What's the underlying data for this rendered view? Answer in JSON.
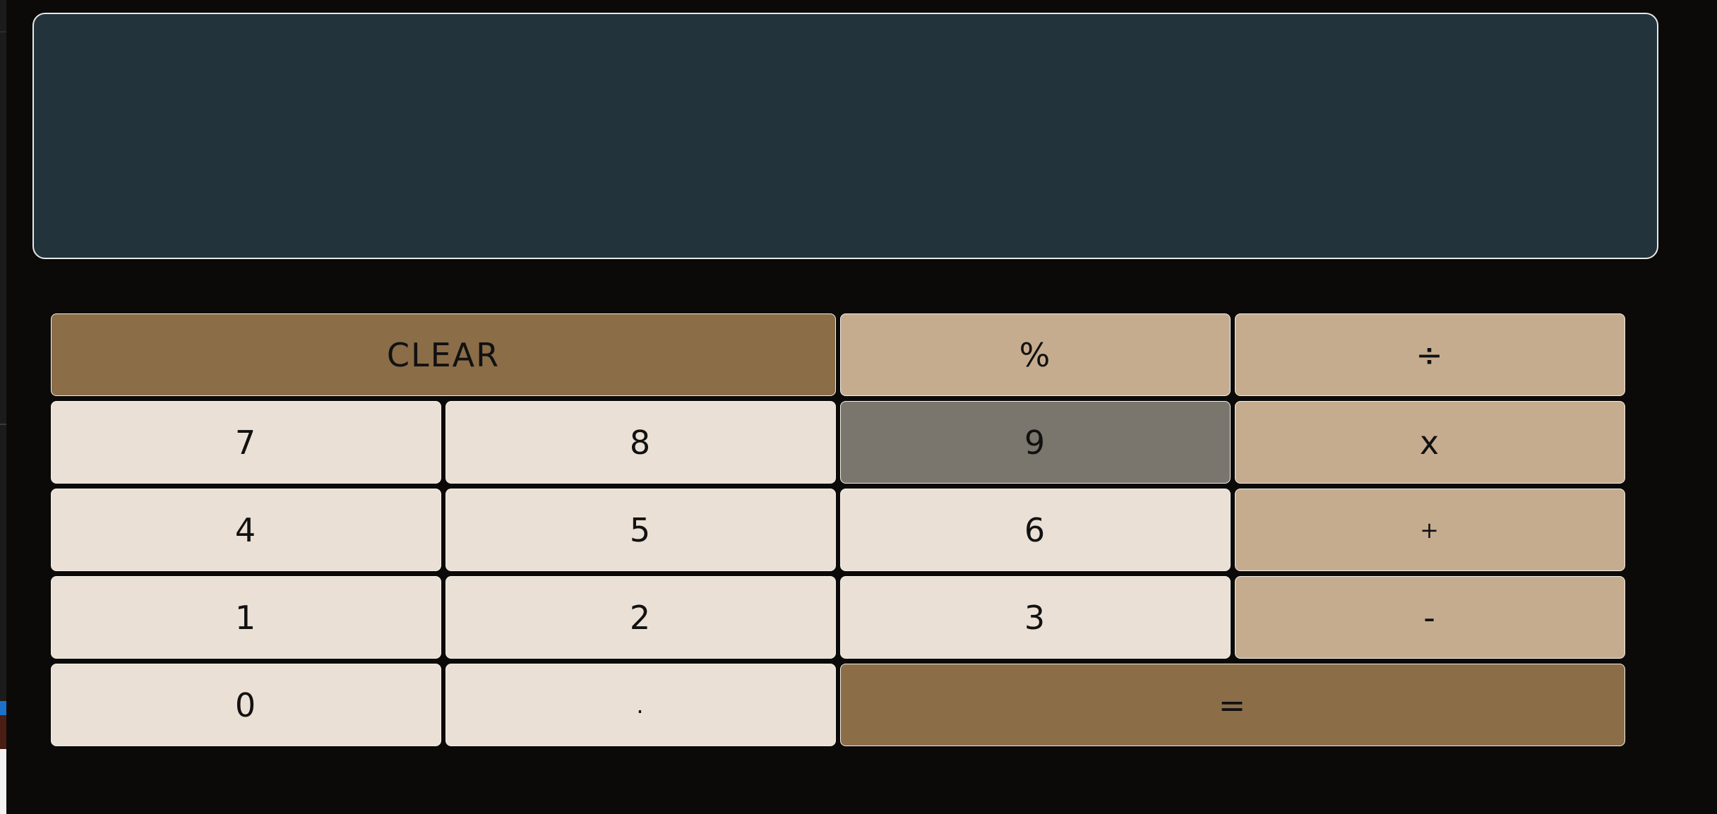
{
  "display": {
    "value": ""
  },
  "keys": [
    {
      "label": "CLEAR",
      "name": "clear-button",
      "kind": "accent",
      "span": 2
    },
    {
      "label": "%",
      "name": "percent-button",
      "kind": "op"
    },
    {
      "label": "÷",
      "name": "divide-button",
      "kind": "op"
    },
    {
      "label": "7",
      "name": "digit-7-button",
      "kind": "num"
    },
    {
      "label": "8",
      "name": "digit-8-button",
      "kind": "num"
    },
    {
      "label": "9",
      "name": "digit-9-button",
      "kind": "pressed"
    },
    {
      "label": "x",
      "name": "multiply-button",
      "kind": "op"
    },
    {
      "label": "4",
      "name": "digit-4-button",
      "kind": "num"
    },
    {
      "label": "5",
      "name": "digit-5-button",
      "kind": "num"
    },
    {
      "label": "6",
      "name": "digit-6-button",
      "kind": "num"
    },
    {
      "label": "+",
      "name": "add-button",
      "kind": "op",
      "small": true
    },
    {
      "label": "1",
      "name": "digit-1-button",
      "kind": "num"
    },
    {
      "label": "2",
      "name": "digit-2-button",
      "kind": "num"
    },
    {
      "label": "3",
      "name": "digit-3-button",
      "kind": "num"
    },
    {
      "label": "-",
      "name": "subtract-button",
      "kind": "op"
    },
    {
      "label": "0",
      "name": "digit-0-button",
      "kind": "num"
    },
    {
      "label": ".",
      "name": "decimal-button",
      "kind": "num",
      "small": true
    },
    {
      "label": "=",
      "name": "equals-button",
      "kind": "accent",
      "span": 2
    }
  ],
  "colors": {
    "background": "#0b0a08",
    "display_bg": "#22333c",
    "number_key": "#eae0d5",
    "operator_key": "#c6ac8f",
    "accent_key": "#8b6d48",
    "pressed_key": "#7a756d"
  }
}
